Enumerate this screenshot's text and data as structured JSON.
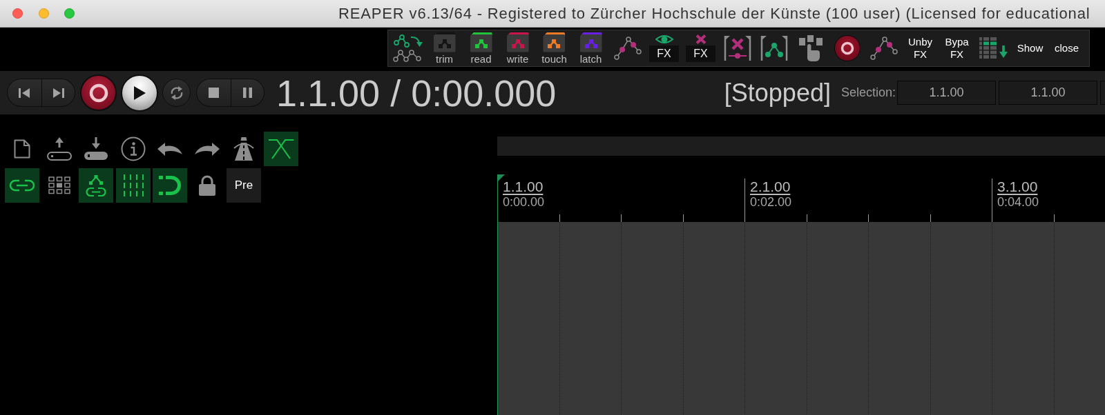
{
  "window": {
    "title": "REAPER v6.13/64 - Registered to Zürcher Hochschule der Künste (100 user) (Licensed for educational"
  },
  "envelope_toolbar": {
    "items": [
      {
        "kind": "nodes"
      },
      {
        "kind": "mode",
        "label": "trim",
        "color": "#141414"
      },
      {
        "kind": "mode",
        "label": "read",
        "color": "#20c43a"
      },
      {
        "kind": "mode",
        "label": "write",
        "color": "#c8164c"
      },
      {
        "kind": "mode",
        "label": "touch",
        "color": "#ef7a26"
      },
      {
        "kind": "mode",
        "label": "latch",
        "color": "#6a1fe6"
      },
      {
        "kind": "envelope"
      },
      {
        "kind": "showfx",
        "label": "FX"
      },
      {
        "kind": "removefx",
        "label": "FX"
      },
      {
        "kind": "bracketx"
      },
      {
        "kind": "bracketnode"
      },
      {
        "kind": "hand"
      },
      {
        "kind": "record"
      },
      {
        "kind": "envelope"
      },
      {
        "kind": "text",
        "label": "Unby\nFX"
      },
      {
        "kind": "text",
        "label": "Bypa\nFX"
      },
      {
        "kind": "grid"
      },
      {
        "kind": "text",
        "label": "Show"
      },
      {
        "kind": "text",
        "label": "close"
      }
    ]
  },
  "transport": {
    "position": "1.1.00 / 0:00.000",
    "status": "[Stopped]",
    "selection_label": "Selection:",
    "selection": [
      "1.1.00",
      "1.1.00"
    ]
  },
  "main_toolbar": {
    "rows": [
      {
        "items": [
          {
            "kind": "file",
            "on": false
          },
          {
            "kind": "upload",
            "on": false
          },
          {
            "kind": "download",
            "on": false
          },
          {
            "kind": "info",
            "on": false
          },
          {
            "kind": "undo",
            "on": false
          },
          {
            "kind": "redo",
            "on": false
          },
          {
            "kind": "metronome",
            "on": false
          },
          {
            "kind": "crossfade",
            "on": true
          }
        ]
      },
      {
        "items": [
          {
            "kind": "link",
            "on": true
          },
          {
            "kind": "grid",
            "on": false
          },
          {
            "kind": "envlink",
            "on": true
          },
          {
            "kind": "gridlines",
            "on": true
          },
          {
            "kind": "snap",
            "on": true
          },
          {
            "kind": "lock",
            "on": false
          },
          {
            "kind": "text",
            "label": "Pre",
            "on": false
          }
        ]
      }
    ]
  },
  "timeline": {
    "markers": [
      {
        "bar": "1.1.00",
        "time": "0:00.00"
      },
      {
        "bar": "2.1.00",
        "time": "0:02.00"
      },
      {
        "bar": "3.1.00",
        "time": "0:04.00"
      }
    ]
  }
}
